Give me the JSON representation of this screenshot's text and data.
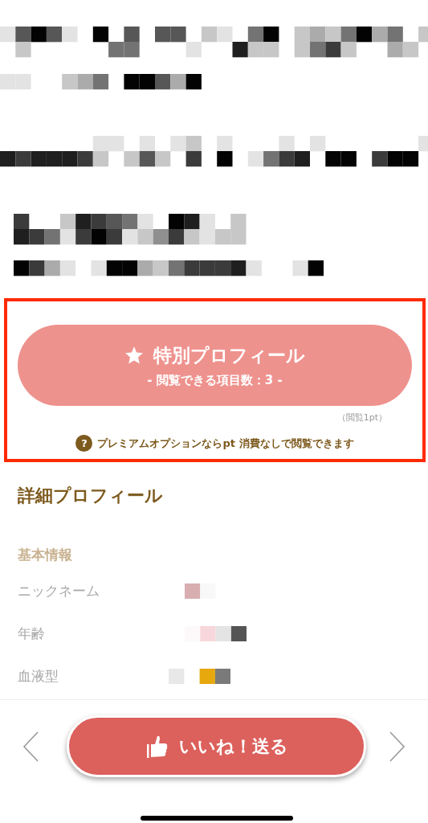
{
  "special_profile": {
    "title": "特別プロフィール",
    "subtitle": "- 閲覧できる項目数：3 -",
    "cost": "（閲覧1pt）",
    "help_mark": "?",
    "premium_note": "プレミアムオプションならpt 消費なしで閲覧できます"
  },
  "detail": {
    "title": "詳細プロフィール",
    "section": "基本情報",
    "rows": [
      {
        "label": "ニックネーム"
      },
      {
        "label": "年齢"
      },
      {
        "label": "血液型"
      }
    ]
  },
  "like_button": {
    "label": "いいね！送る"
  }
}
